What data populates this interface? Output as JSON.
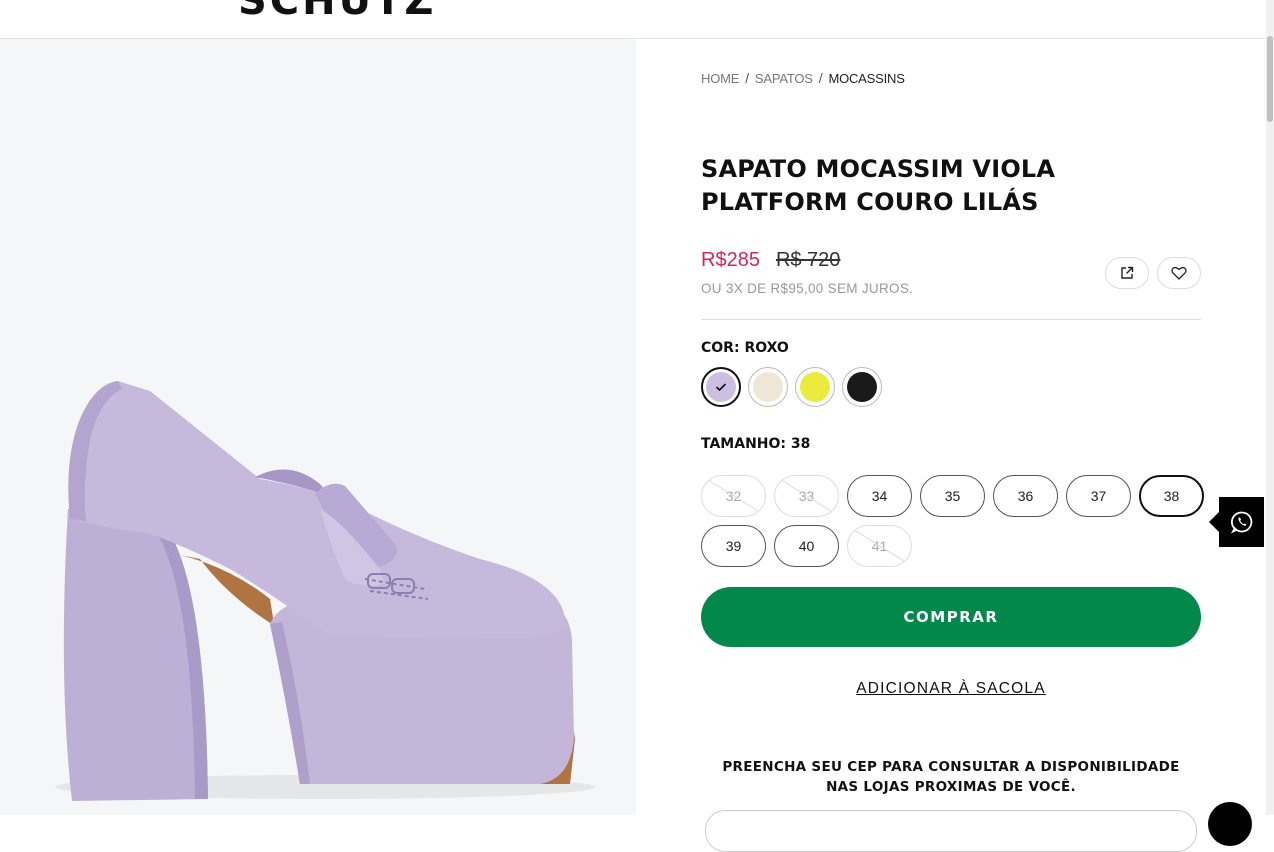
{
  "header": {
    "logo_text": "SCHUTZ"
  },
  "breadcrumb": [
    {
      "label": "HOME"
    },
    {
      "label": "SAPATOS"
    },
    {
      "label": "MOCASSINS"
    }
  ],
  "product": {
    "title": "SAPATO MOCASSIM VIOLA PLATFORM COURO LILÁS",
    "price": "R$285",
    "old_price": "R$ 720",
    "installments": "OU 3X DE R$95,00 SEM JUROS.",
    "image_alt_icon": "shoe-image"
  },
  "color": {
    "label": "COR:",
    "selected": "ROXO",
    "swatches": [
      {
        "name": "roxo",
        "hex": "#cdbfe2",
        "selected": true
      },
      {
        "name": "bege",
        "hex": "#efe7d6",
        "selected": false
      },
      {
        "name": "amarelo",
        "hex": "#ebea3f",
        "selected": false
      },
      {
        "name": "preto",
        "hex": "#1a1a1a",
        "selected": false
      }
    ]
  },
  "size": {
    "label": "TAMANHO:",
    "selected": "38",
    "options": [
      {
        "value": "32",
        "available": false
      },
      {
        "value": "33",
        "available": false
      },
      {
        "value": "34",
        "available": true
      },
      {
        "value": "35",
        "available": true
      },
      {
        "value": "36",
        "available": true
      },
      {
        "value": "37",
        "available": true
      },
      {
        "value": "38",
        "available": true,
        "selected": true
      },
      {
        "value": "39",
        "available": true
      },
      {
        "value": "40",
        "available": true
      },
      {
        "value": "41",
        "available": false
      }
    ]
  },
  "actions": {
    "buy_label": "COMPRAR",
    "add_to_bag_label": "ADICIONAR À SACOLA",
    "share_icon": "share-icon",
    "favorite_icon": "heart-icon"
  },
  "store_pickup": {
    "line1": "PREENCHA SEU CEP PARA CONSULTAR A DISPONIBILIDADE",
    "line2": "NAS LOJAS PROXIMAS DE VOCÊ."
  },
  "colors": {
    "price": "#d8245a",
    "buy_button": "#02884a",
    "product_lilac": "#c3b6d9"
  }
}
